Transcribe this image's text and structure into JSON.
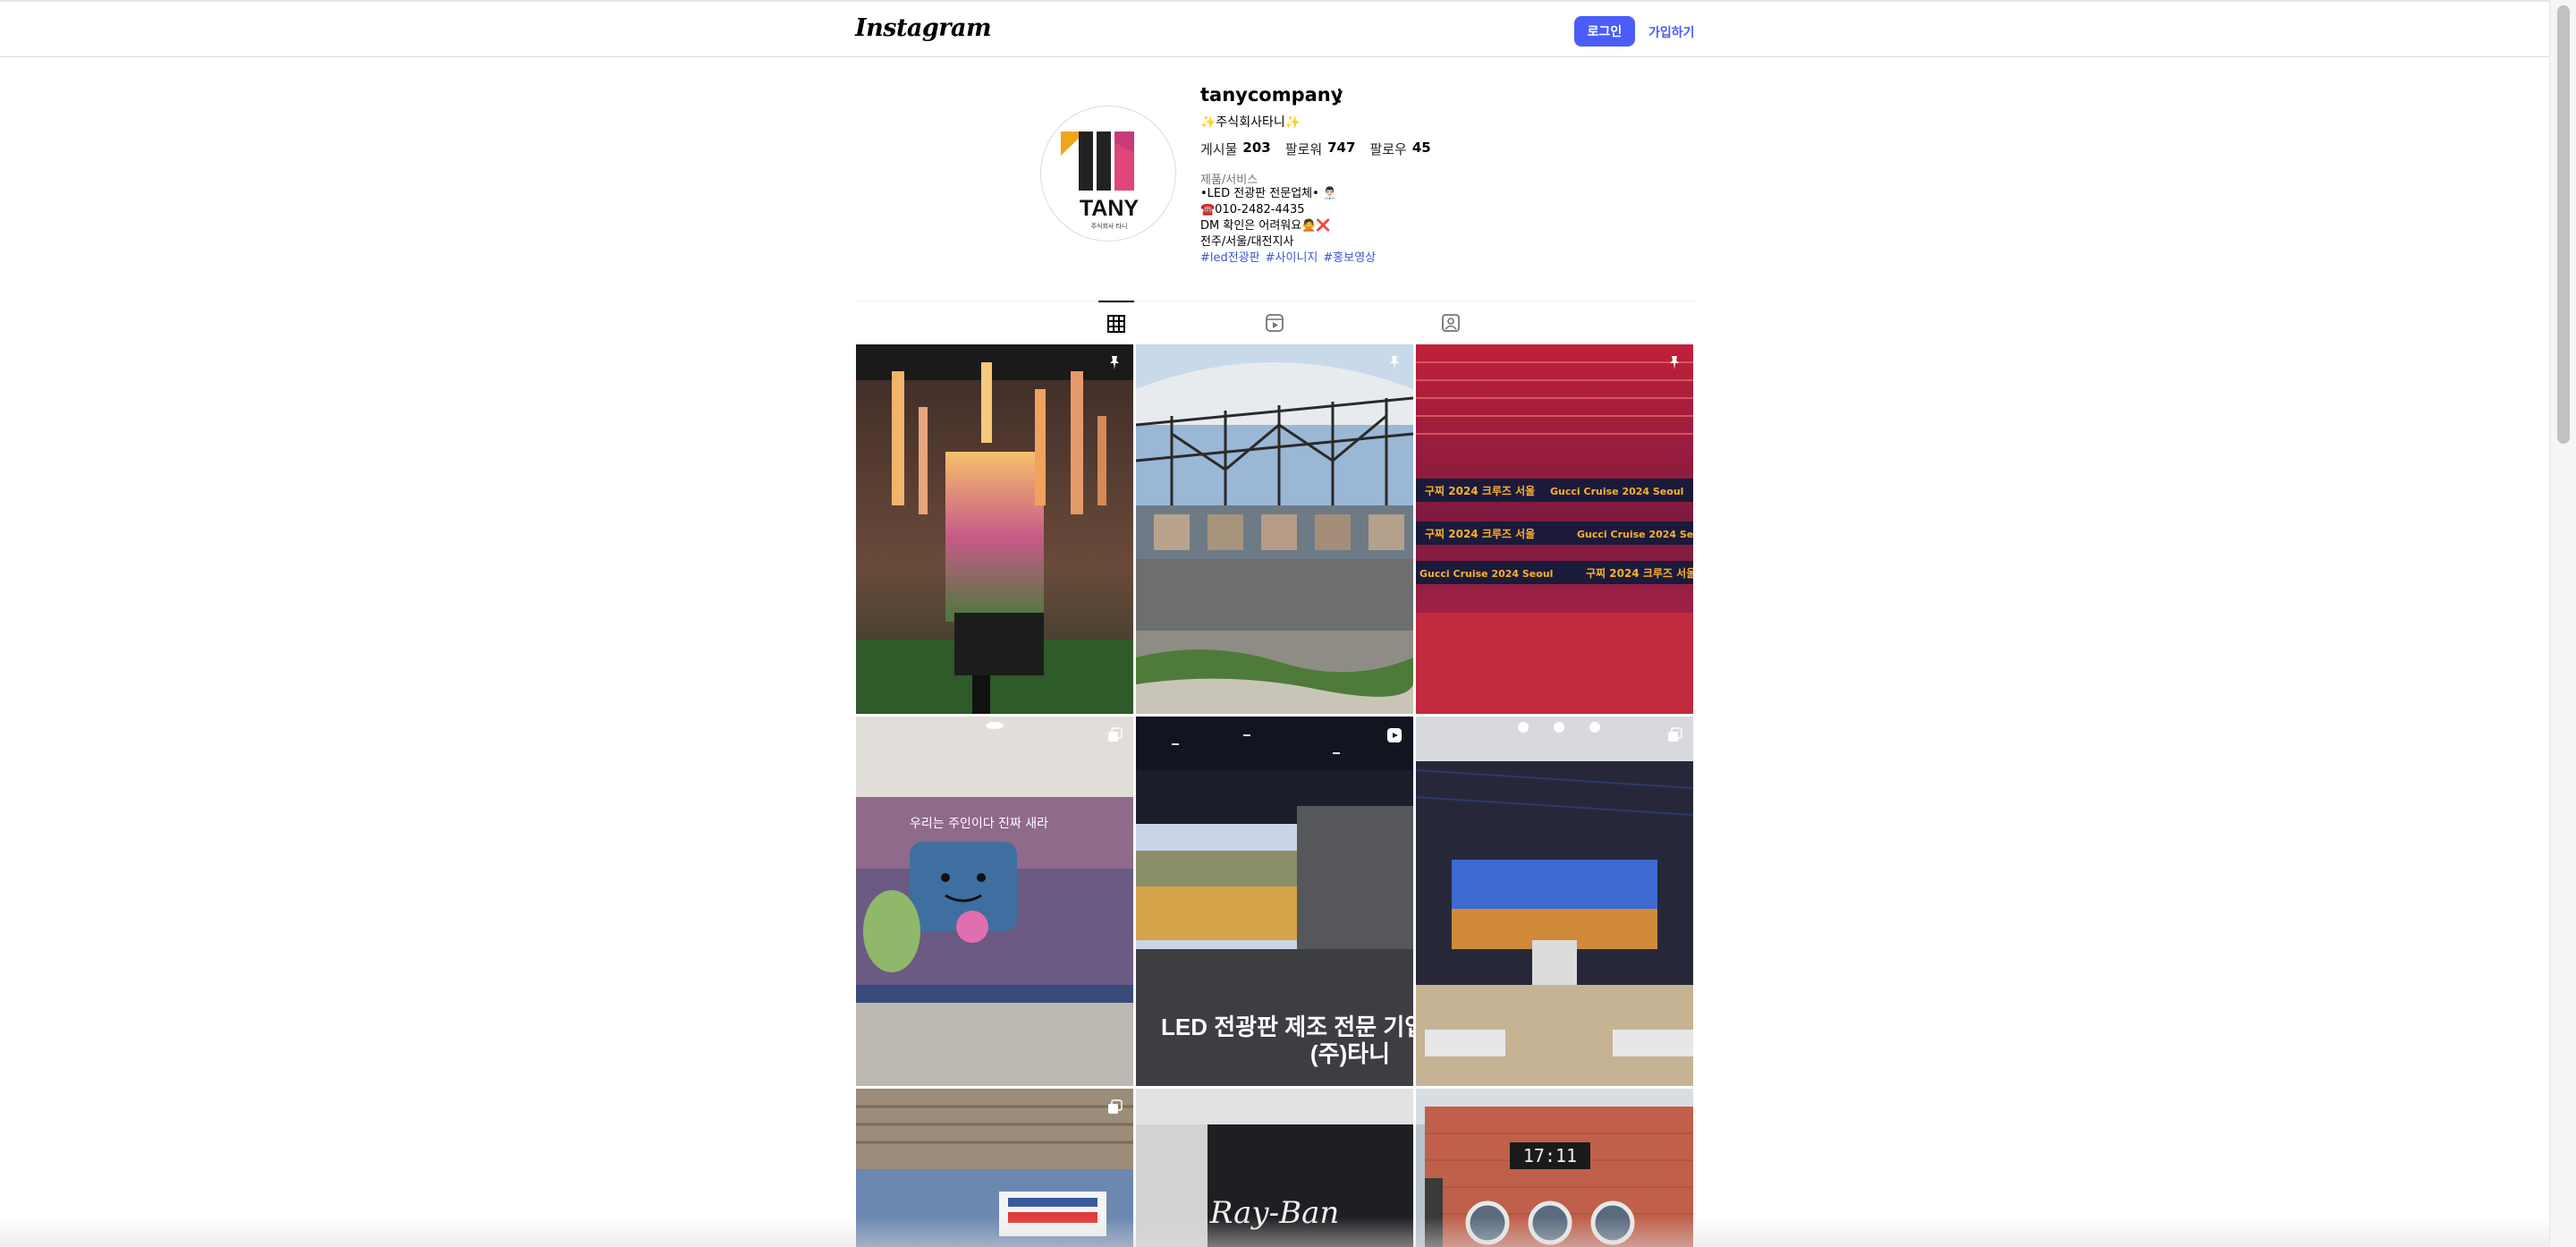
{
  "header": {
    "logo": "Instagram",
    "login_label": "로그인",
    "signup_label": "가입하기"
  },
  "profile": {
    "username": "tanycompany",
    "display_name": "✨주식회사타니✨",
    "stats": [
      {
        "label": "게시물",
        "value": "203"
      },
      {
        "label": "팔로워",
        "value": "747"
      },
      {
        "label": "팔로우",
        "value": "45"
      }
    ],
    "category": "제품/서비스",
    "bio_lines": [
      "•LED 전광판 전문업체• 👨🏻‍💼",
      "☎️010-2482-4435",
      "DM 확인은 어려워요🙅❌",
      "전주/서울/대전지사"
    ],
    "hashtags": [
      "#led전광판",
      "#사이니지",
      "#홍보영상"
    ],
    "avatar": {
      "text": "TANY",
      "subtext": "주식회사 타니"
    }
  },
  "tabs": [
    {
      "icon": "grid-icon",
      "active": true
    },
    {
      "icon": "reels-icon",
      "active": false
    },
    {
      "icon": "tagged-icon",
      "active": false
    }
  ],
  "posts": [
    {
      "badge": "pin-icon",
      "caption": ""
    },
    {
      "badge": "pin-icon",
      "caption": ""
    },
    {
      "badge": "pin-icon",
      "caption": "",
      "overlay": [
        "구찌 2024 크루즈 서울",
        "Gucci Cruise 2024 Seoul"
      ]
    },
    {
      "badge": "carousel-icon",
      "caption": "우리는 주인이다 진짜 새라"
    },
    {
      "badge": "reel-icon",
      "caption": "LED 전광판 제조 전문 기업",
      "caption2": "(주)타니"
    },
    {
      "badge": "carousel-icon",
      "caption": ""
    },
    {
      "badge": "carousel-icon",
      "caption": ""
    },
    {
      "badge": "",
      "caption": "Ray-Ban"
    },
    {
      "badge": "",
      "caption": "17:11"
    }
  ],
  "colors": {
    "accent": "#4a5df9",
    "hashtag": "#3a57d4",
    "border": "#dbdbdb"
  }
}
